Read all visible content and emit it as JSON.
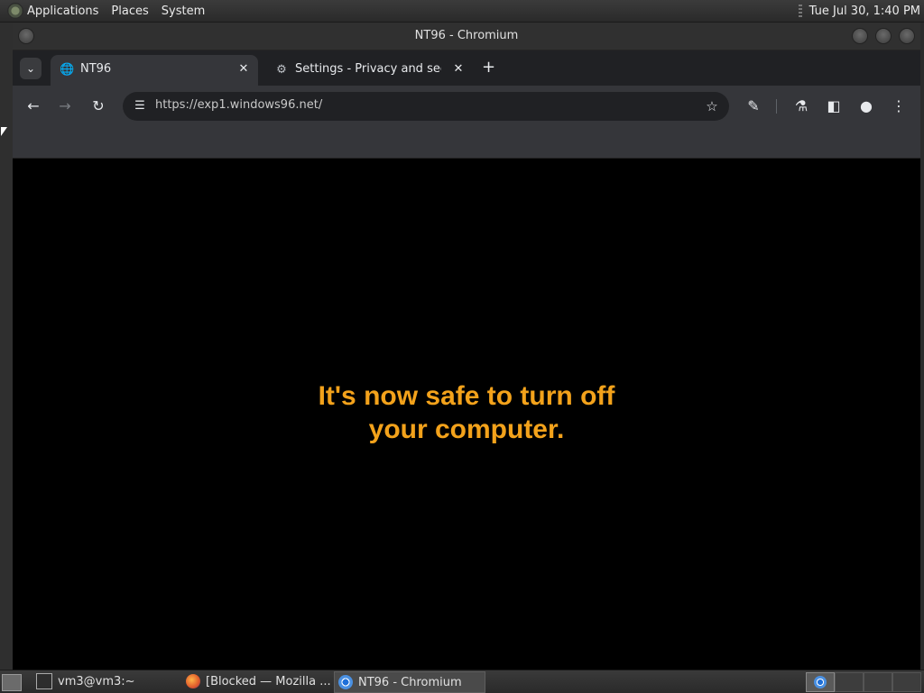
{
  "panel": {
    "menus": [
      "Applications",
      "Places",
      "System"
    ],
    "clock": "Tue Jul 30,  1:40 PM"
  },
  "window": {
    "title": "NT96 - Chromium"
  },
  "tabs": [
    {
      "label": "NT96",
      "icon": "globe-icon",
      "active": true
    },
    {
      "label": "Settings - Privacy and securi",
      "icon": "gear-icon",
      "active": false
    }
  ],
  "toolbar": {
    "url": "https://exp1.windows96.net/"
  },
  "page": {
    "line1": "It's now safe to turn off",
    "line2": "your computer.",
    "text_color": "#f3a21b"
  },
  "taskbar": {
    "tasks": [
      {
        "label": "vm3@vm3:~",
        "icon": "terminal-icon"
      },
      {
        "label": "[Blocked — Mozilla ...",
        "icon": "firefox-icon"
      },
      {
        "label": "NT96 - Chromium",
        "icon": "chromium-icon",
        "active": true
      }
    ]
  }
}
